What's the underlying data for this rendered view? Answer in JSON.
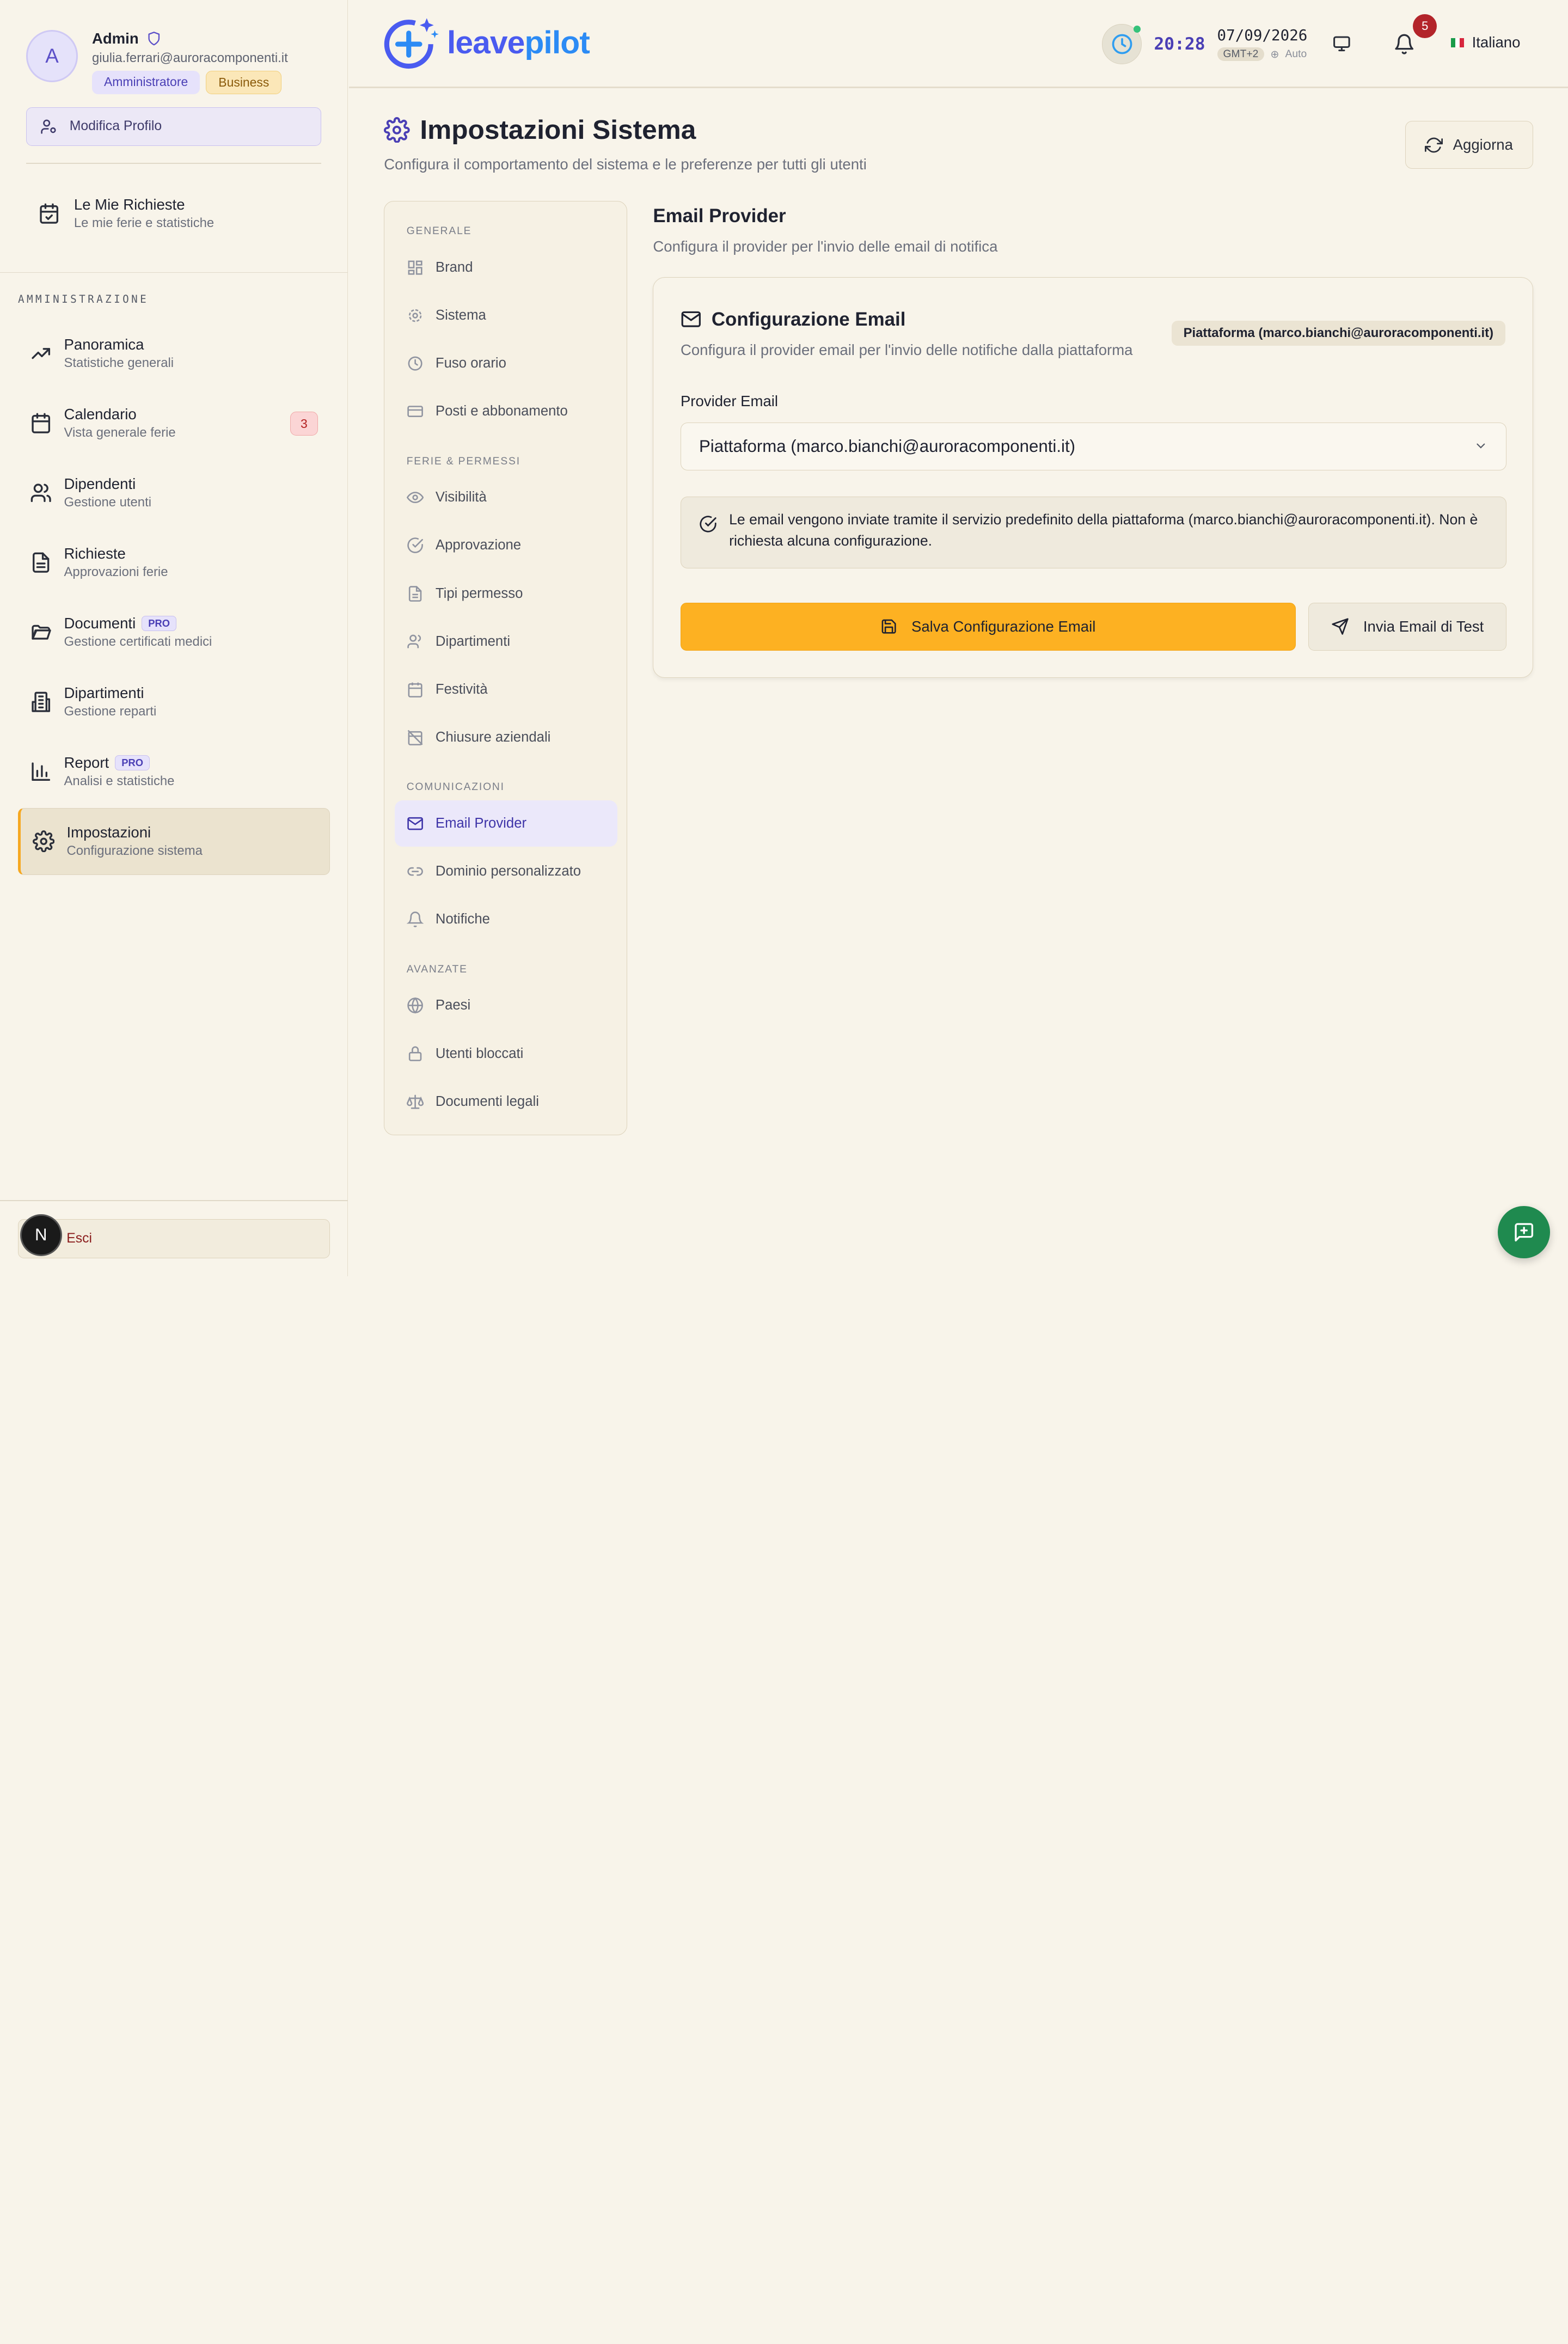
{
  "user": {
    "initial": "A",
    "name": "Admin",
    "email": "giulia.ferrari@auroracomponenti.it",
    "role": "Amministratore",
    "plan": "Business",
    "edit_profile": "Modifica Profilo"
  },
  "my_requests": {
    "title": "Le Mie Richieste",
    "sub": "Le mie ferie e statistiche"
  },
  "admin_section": "AMMINISTRAZIONE",
  "nav": [
    {
      "title": "Panoramica",
      "sub": "Statistiche generali",
      "icon": "trending-up-icon"
    },
    {
      "title": "Calendario",
      "sub": "Vista generale ferie",
      "icon": "calendar-icon",
      "count": "3"
    },
    {
      "title": "Dipendenti",
      "sub": "Gestione utenti",
      "icon": "users-icon"
    },
    {
      "title": "Richieste",
      "sub": "Approvazioni ferie",
      "icon": "file-text-icon"
    },
    {
      "title": "Documenti",
      "sub": "Gestione certificati medici",
      "icon": "folder-open-icon",
      "pro": "PRO"
    },
    {
      "title": "Dipartimenti",
      "sub": "Gestione reparti",
      "icon": "building-icon"
    },
    {
      "title": "Report",
      "sub": "Analisi e statistiche",
      "icon": "bar-chart-icon",
      "pro": "PRO"
    },
    {
      "title": "Impostazioni",
      "sub": "Configurazione sistema",
      "icon": "gear-icon",
      "active": true
    }
  ],
  "logout": {
    "label": "Esci",
    "avatar_letter": "N"
  },
  "topbar": {
    "logo_a": "leave",
    "logo_b": "pilot",
    "time": "20:28",
    "date": "07/09/2026",
    "timezone": "GMT+2",
    "tz_mode": "Auto",
    "notifications": "5",
    "language": "Italiano"
  },
  "page": {
    "title": "Impostazioni Sistema",
    "subtitle": "Configura il comportamento del sistema e le preferenze per tutti gli utenti",
    "refresh": "Aggiorna"
  },
  "settings_nav": {
    "sections": [
      {
        "heading": "GENERALE",
        "items": [
          "Brand",
          "Sistema",
          "Fuso orario",
          "Posti e abbonamento"
        ]
      },
      {
        "heading": "FERIE & PERMESSI",
        "items": [
          "Visibilità",
          "Approvazione",
          "Tipi permesso",
          "Dipartimenti",
          "Festività",
          "Chiusure aziendali"
        ]
      },
      {
        "heading": "COMUNICAZIONI",
        "items": [
          "Email Provider",
          "Dominio personalizzato",
          "Notifiche"
        ]
      },
      {
        "heading": "AVANZATE",
        "items": [
          "Paesi",
          "Utenti bloccati",
          "Documenti legali"
        ]
      }
    ],
    "active": "Email Provider"
  },
  "content": {
    "title": "Email Provider",
    "subtitle": "Configura il provider per l'invio delle email di notifica",
    "card_title": "Configurazione Email",
    "card_sub": "Configura il provider email per l'invio delle notifiche dalla piattaforma",
    "card_badge": "Piattaforma (marco.bianchi@auroracomponenti.it)",
    "provider_label": "Provider Email",
    "provider_value": "Piattaforma (marco.bianchi@auroracomponenti.it)",
    "info": "Le email vengono inviate tramite il servizio predefinito della piattaforma (marco.bianchi@auroracomponenti.it). Non è richiesta alcuna configurazione.",
    "save_button": "Salva Configurazione Email",
    "test_button": "Invia Email di Test"
  },
  "colors": {
    "accent": "#fdb122",
    "brand": "#4a5bf0",
    "primary_purple": "#4a3fb5",
    "fab": "#1f8a4f"
  }
}
